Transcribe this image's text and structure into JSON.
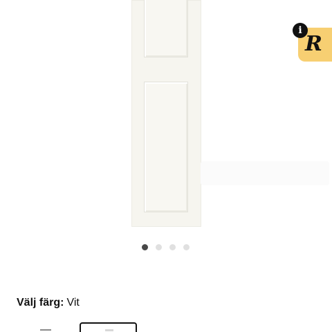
{
  "product": {
    "image_alt": "Vit dörr",
    "gallery_count": 4,
    "gallery_active_index": 0
  },
  "color_selector": {
    "label": "Välj färg:",
    "value": "Vit",
    "swatches": [
      {
        "name": "prev-swatch",
        "selected": false
      },
      {
        "name": "Vit",
        "selected": true
      }
    ]
  },
  "extension_badge": {
    "letter": "R",
    "info_glyph": "i",
    "color": "#f7cf72"
  },
  "icons": {
    "info": "info-icon",
    "extension": "extension-logo-icon"
  },
  "colors": {
    "active_dot": "#484848",
    "inactive_dot": "#e0e0e0",
    "badge": "#f7cf72"
  }
}
